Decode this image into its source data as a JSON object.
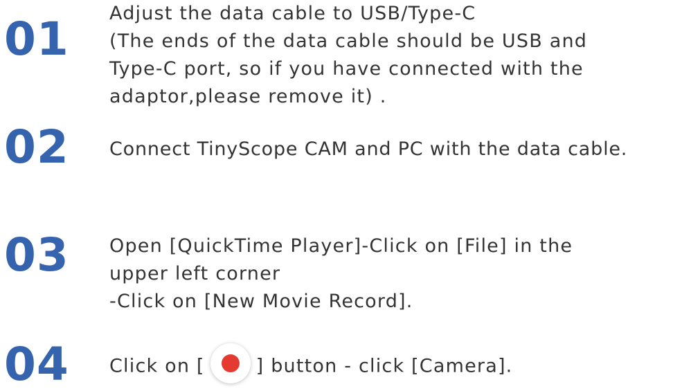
{
  "steps": [
    {
      "number": "01",
      "lines": [
        "Adjust the data cable to USB/Type-C",
        "(The ends of the data cable should be USB and",
        "Type-C port, so if you have connected  with the",
        "adaptor,please remove it) ."
      ]
    },
    {
      "number": "02",
      "lines": [
        "Connect TinyScope CAM and PC with the data cable."
      ]
    },
    {
      "number": "03",
      "lines": [
        "Open [QuickTime Player]-Click on [File] in the",
        "upper left corner",
        "-Click on [New Movie Record]."
      ]
    },
    {
      "number": "04",
      "before_icon": "Click on [",
      "after_icon": "] button - click [Camera].",
      "icon": "record-button-icon",
      "icon_color": "#e43a2f"
    }
  ],
  "colors": {
    "number": "#3563ad",
    "text": "#333333"
  }
}
